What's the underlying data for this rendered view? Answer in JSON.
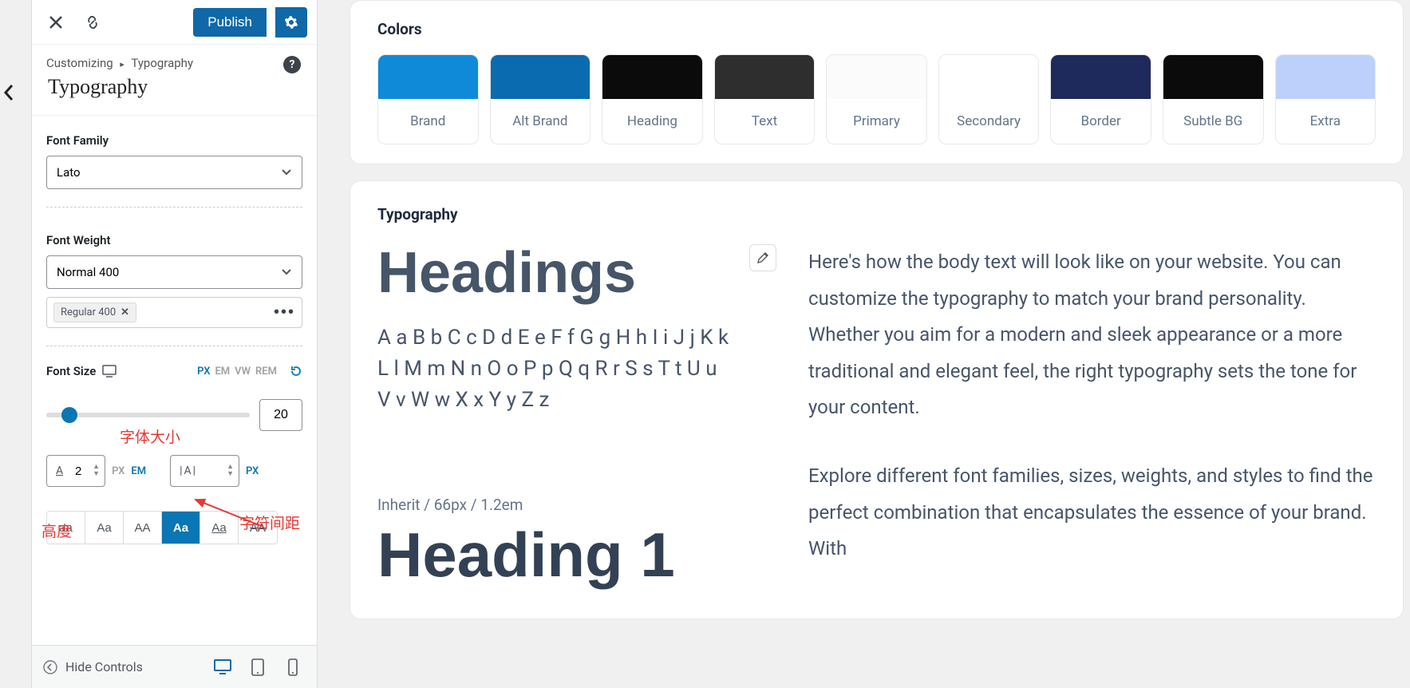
{
  "topbar": {
    "publish": "Publish"
  },
  "breadcrumb": {
    "root": "Customizing",
    "path": "Typography",
    "title": "Typography"
  },
  "controls": {
    "font_family_label": "Font Family",
    "font_family_value": "Lato",
    "font_weight_label": "Font Weight",
    "font_weight_value": "Normal 400",
    "font_weight_chip": "Regular 400",
    "font_size_label": "Font Size",
    "units": {
      "px": "PX",
      "em": "EM",
      "vw": "VW",
      "rem": "REM"
    },
    "font_size_value": "20",
    "line_height_value": "2",
    "letter_spacing_value": "",
    "transforms": {
      "aa": "aa",
      "Aa": "Aa",
      "AA": "AA",
      "active": "Aa",
      "underline": "Aa",
      "strike": "AA"
    }
  },
  "annotations": {
    "font_size": "字体大小",
    "height": "高度",
    "letter_spacing": "字符间距"
  },
  "footer": {
    "hide_controls": "Hide Controls"
  },
  "preview": {
    "colors_title": "Colors",
    "swatches": [
      {
        "label": "Brand",
        "color": "#0f8ad9"
      },
      {
        "label": "Alt Brand",
        "color": "#0a6bb0"
      },
      {
        "label": "Heading",
        "color": "#0b0b0b"
      },
      {
        "label": "Text",
        "color": "#2e2e2e"
      },
      {
        "label": "Primary",
        "color": "#fbfbfb"
      },
      {
        "label": "Secondary",
        "color": "#ffffff"
      },
      {
        "label": "Border",
        "color": "#1f2a5c"
      },
      {
        "label": "Subtle BG",
        "color": "#0b0b0b"
      },
      {
        "label": "Extra",
        "color": "#bcd0fb"
      }
    ],
    "typo_title": "Typography",
    "headings_label": "Headings",
    "alphabet_1": "A a B b C c D d E e F f G g H h I i J j K k",
    "alphabet_2": "L l M m N n O o P p Q q R r S s T t U u",
    "alphabet_3": "V v W w X x Y y Z z",
    "body_p1": "Here's how the body text will look like on your website. You can customize the typography to match your brand personality. Whether you aim for a modern and sleek appearance or a more traditional and elegant feel, the right typography sets the tone for your content.",
    "body_p2": "Explore different font families, sizes, weights, and styles to find the perfect combination that encapsulates the essence of your brand. With",
    "inherit_label": "Inherit / 66px / 1.2em",
    "heading1": "Heading 1"
  }
}
